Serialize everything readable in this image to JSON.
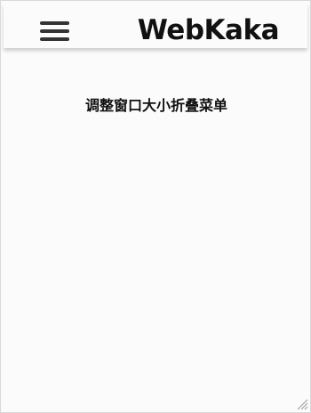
{
  "header": {
    "brand": "WebKaka"
  },
  "main": {
    "hint_text": "调整窗口大小折叠菜单"
  },
  "icons": {
    "menu": "hamburger-menu-icon",
    "resize": "resize-grip-icon"
  }
}
